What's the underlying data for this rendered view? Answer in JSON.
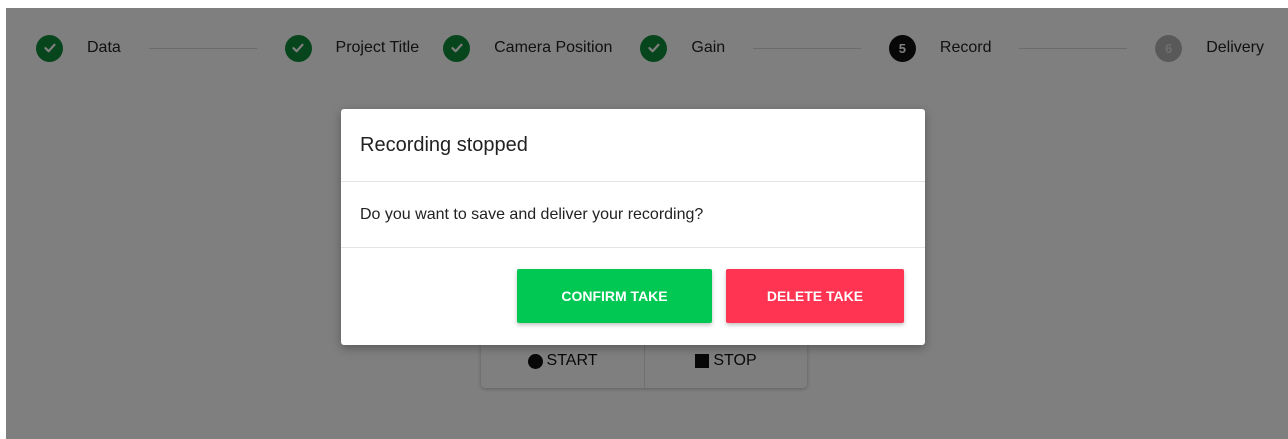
{
  "stepper": {
    "steps": [
      {
        "label": "Data",
        "status": "done",
        "number": ""
      },
      {
        "label": "Project Title",
        "status": "done",
        "number": ""
      },
      {
        "label": "Camera Position",
        "status": "done",
        "number": ""
      },
      {
        "label": "Gain",
        "status": "done",
        "number": ""
      },
      {
        "label": "Record",
        "status": "active",
        "number": "5"
      },
      {
        "label": "Delivery",
        "status": "pending",
        "number": "6"
      }
    ]
  },
  "controls": {
    "start_label": "START",
    "stop_label": "STOP"
  },
  "modal": {
    "title": "Recording stopped",
    "message": "Do you want to save and deliver your recording?",
    "confirm_label": "CONFIRM TAKE",
    "delete_label": "DELETE TAKE"
  },
  "colors": {
    "done": "#0f8a38",
    "active": "#111111",
    "pending": "#b3b3b3",
    "confirm": "#00c853",
    "delete": "#ff3352",
    "overlay": "rgba(0,0,0,0.5)"
  }
}
